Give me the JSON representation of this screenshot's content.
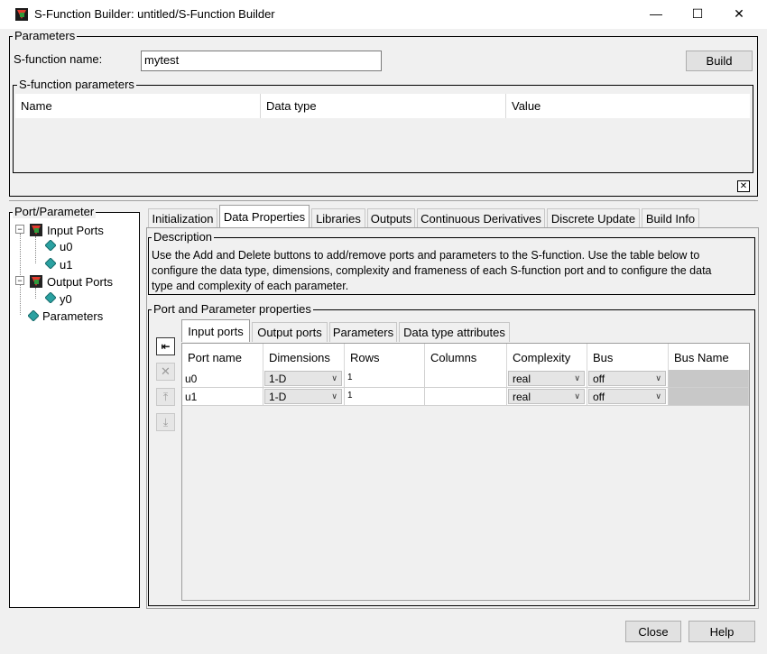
{
  "window": {
    "title": "S-Function Builder: untitled/S-Function Builder",
    "minimize": "—",
    "maximize": "☐",
    "close": "✕"
  },
  "parameters": {
    "group_label": "Parameters",
    "name_label": "S-function name:",
    "name_value": "mytest",
    "build_label": "Build",
    "sfun_params": {
      "group_label": "S-function parameters",
      "columns": [
        "Name",
        "Data type",
        "Value"
      ]
    },
    "close_icon": "✕"
  },
  "tree": {
    "group_label": "Port/Parameter",
    "input_ports": "Input Ports",
    "inputs": [
      "u0",
      "u1"
    ],
    "output_ports": "Output Ports",
    "outputs": [
      "y0"
    ],
    "parameters": "Parameters"
  },
  "tabs": [
    "Initialization",
    "Data Properties",
    "Libraries",
    "Outputs",
    "Continuous Derivatives",
    "Discrete Update",
    "Build Info"
  ],
  "active_tab": "Data Properties",
  "description": {
    "group_label": "Description",
    "line1": "Use the Add and Delete buttons to add/remove ports and parameters to the S-function. Use the table below to",
    "line2": "configure the data type, dimensions, complexity and frameness of each S-function port and to configure the data",
    "line3": "type and complexity of each parameter."
  },
  "port_props": {
    "group_label": "Port and Parameter properties",
    "subtabs": [
      "Input ports",
      "Output ports",
      "Parameters",
      "Data type attributes"
    ],
    "active_subtab": "Input ports",
    "columns": [
      "Port name",
      "Dimensions",
      "Rows",
      "Columns",
      "Complexity",
      "Bus",
      "Bus Name"
    ],
    "rows": [
      {
        "port_name": "u0",
        "dimensions": "1-D",
        "rows": "1",
        "columns": "",
        "complexity": "real",
        "bus": "off",
        "bus_name": ""
      },
      {
        "port_name": "u1",
        "dimensions": "1-D",
        "rows": "1",
        "columns": "",
        "complexity": "real",
        "bus": "off",
        "bus_name": ""
      }
    ],
    "tools": [
      "add-icon",
      "delete-icon",
      "move-up-icon",
      "move-down-icon"
    ]
  },
  "footer": {
    "close_label": "Close",
    "help_label": "Help"
  }
}
